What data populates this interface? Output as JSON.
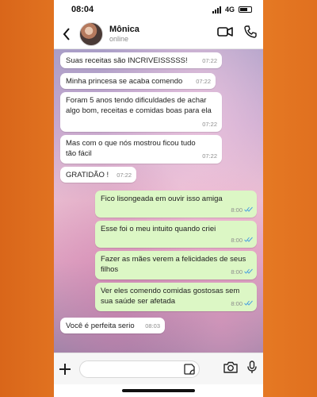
{
  "status_bar": {
    "time": "08:04",
    "network": "4G"
  },
  "header": {
    "contact_name": "Mônica",
    "contact_status": "online"
  },
  "messages": [
    {
      "direction": "in",
      "text": "Suas receitas são INCRIVEISSSSS!",
      "time": "07:22"
    },
    {
      "direction": "in",
      "text": "Minha princesa se acaba comendo",
      "time": "07:22"
    },
    {
      "direction": "in",
      "text": "Foram 5 anos tendo dificuldades de achar algo bom, receitas e comidas boas para ela",
      "time": "07:22"
    },
    {
      "direction": "in",
      "text": "Mas com o que nós mostrou ficou tudo tão fácil",
      "time": "07:22"
    },
    {
      "direction": "in",
      "text": "GRATIDÃO !",
      "time": "07:22"
    },
    {
      "direction": "out",
      "text": "Fico lisongeada em ouvir isso amiga",
      "time": "8:00"
    },
    {
      "direction": "out",
      "text": "Esse foi o meu intuito quando criei",
      "time": "8:00"
    },
    {
      "direction": "out",
      "text": "Fazer as mães verem a felicidades de seus filhos",
      "time": "8:00"
    },
    {
      "direction": "out",
      "text": "Ver eles comendo comidas gostosas sem sua saúde ser afetada",
      "time": "8:00"
    },
    {
      "direction": "in",
      "text": "Você é perfeita serio",
      "time": "08:03"
    }
  ],
  "composer": {
    "placeholder": ""
  },
  "colors": {
    "outgoing_bubble": "#dcf7c5",
    "incoming_bubble": "#ffffff",
    "read_ticks": "#4fa3e0"
  },
  "icons": [
    "back-icon",
    "video-call-icon",
    "phone-call-icon",
    "plus-icon",
    "sticker-icon",
    "camera-icon",
    "microphone-icon"
  ]
}
